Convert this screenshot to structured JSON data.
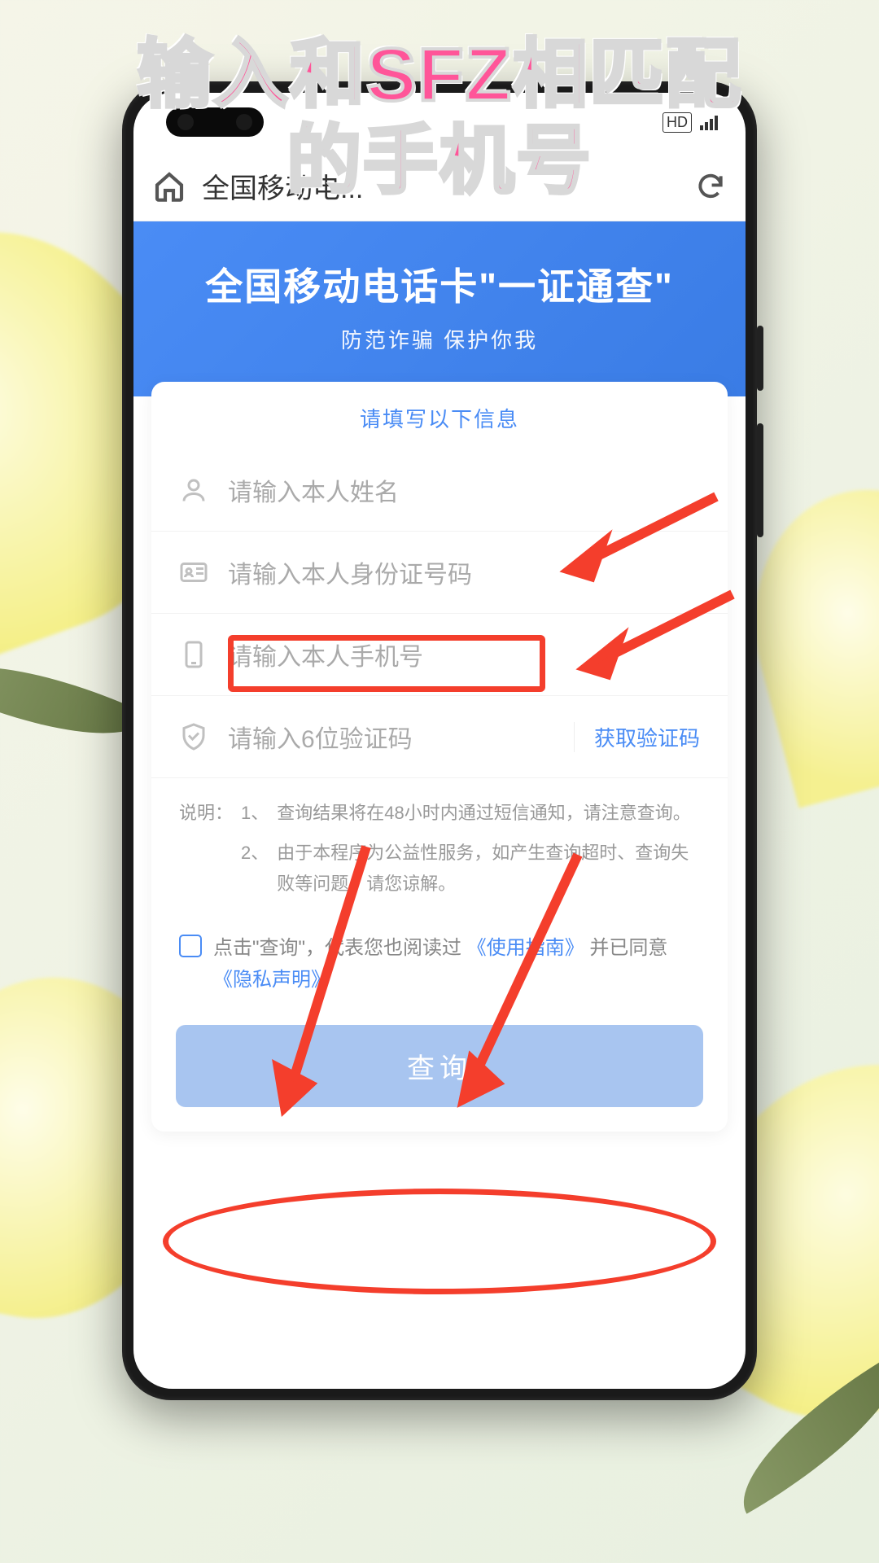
{
  "overlay": {
    "line1": "输入和SFZ相匹配",
    "line2": "的手机号"
  },
  "browser": {
    "address": "全国移动电..."
  },
  "banner": {
    "title": "全国移动电话卡\"一证通查\"",
    "subtitle": "防范诈骗 保护你我"
  },
  "form": {
    "title": "请填写以下信息",
    "name_ph": "请输入本人姓名",
    "id_ph": "请输入本人身份证号码",
    "phone_ph": "请输入本人手机号",
    "code_ph": "请输入6位验证码",
    "get_code": "获取验证码"
  },
  "notes": {
    "label": "说明：",
    "n1_idx": "1、",
    "n1": "查询结果将在48小时内通过短信通知，请注意查询。",
    "n2_idx": "2、",
    "n2": "由于本程序为公益性服务，如产生查询超时、查询失败等问题，请您谅解。"
  },
  "agree": {
    "prefix": "点击\"查询\"，代表您也阅读过",
    "guide": "《使用指南》",
    "mid": "并已同意",
    "privacy": "《隐私声明》"
  },
  "submit_label": "查询"
}
